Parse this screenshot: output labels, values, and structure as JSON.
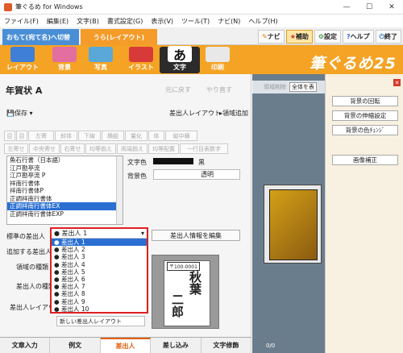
{
  "window": {
    "title": "筆ぐるめ for Windows"
  },
  "menu": [
    "ファイル(F)",
    "編集(E)",
    "文字(B)",
    "書式設定(G)",
    "表示(V)",
    "ツール(T)",
    "ナビ(N)",
    "ヘルプ(H)"
  ],
  "mode_tabs": {
    "back": "おもて(宛て名)へ切替",
    "current": "うら(レイアウト)"
  },
  "top_buttons": [
    "ナビ",
    "補助",
    "設定",
    "ヘルプ",
    "終了"
  ],
  "ribbon": {
    "items": [
      "レイアウト",
      "背景",
      "写真",
      "イラスト",
      "文字",
      "印刷"
    ],
    "selected": "文字",
    "brand": "筆ぐるめ25"
  },
  "panel": {
    "title": "年賀状 A",
    "undo": "元に戻す",
    "redo": "やり直す",
    "save": "保存",
    "sender_layout": "差出人レイアウト",
    "area_add": "領域追加",
    "row1": [
      "目",
      "目",
      "左寄",
      "斜体",
      "下線",
      "横組",
      "量化",
      "体",
      "縦中横"
    ],
    "row2": [
      "左寄せ",
      "中央寄せ",
      "右寄せ",
      "均等揃え",
      "両端揃え",
      "均等配置",
      "一行目表数字"
    ],
    "fonts": [
      "魚石行書（日本語）",
      "江戸勘亭流",
      "江戸勘亭流 P",
      "祥南行書体",
      "祥南行書体P",
      "正調祥南行書体",
      "正調祥南行書体EX",
      "正調祥南行書体EXP"
    ],
    "selected_font": "正調祥南行書体EX",
    "char_color_label": "文字色",
    "char_color_value": "黒",
    "bg_color_label": "背景色",
    "bg_color_value": "透明",
    "sender_label": "標準の差出人",
    "sender_value": "差出人 1",
    "edit_sender": "差出人情報を編集",
    "add_sender_label": "追加する差出人",
    "area_type_label": "領域の種類",
    "sender_type_label": "差出人の種類",
    "sender_layout_label": "差出人レイアウト",
    "new_layout": "新しい差出人レイアウト",
    "dropdown_options": [
      "差出人 1",
      "差出人 2",
      "差出人 3",
      "差出人 4",
      "差出人 5",
      "差出人 6",
      "差出人 7",
      "差出人 8",
      "差出人 9",
      "差出人 10"
    ],
    "dropdown_selected": "差出人 1"
  },
  "preview_card": {
    "postal": "〒100-0001",
    "name1": "秋葉",
    "name2": "二郎"
  },
  "bottom_tabs": [
    "文章入力",
    "例文",
    "差出人",
    "差し込み",
    "文字修飾"
  ],
  "bottom_active": "差出人",
  "center": {
    "delete": "領域削除",
    "view": "全体を表",
    "page": "0/0"
  },
  "right_panel": {
    "buttons": [
      "背景の回転",
      "背景の伸縮設定",
      "背景の色ﾁｪﾝｼﾞ",
      "画像補正"
    ]
  }
}
